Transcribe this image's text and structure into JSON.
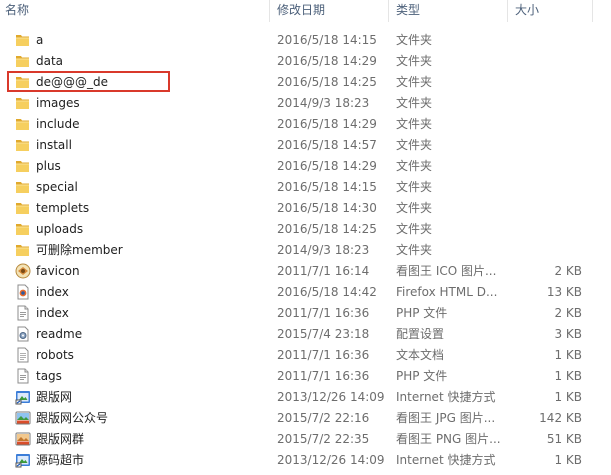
{
  "columns": {
    "name": "名称",
    "date": "修改日期",
    "type": "类型",
    "size": "大小"
  },
  "colors": {
    "folder": "#f0c24a",
    "highlight": "#d9392b"
  },
  "files": [
    {
      "name": "a",
      "date": "2016/5/18 14:15",
      "type": "文件夹",
      "size": "",
      "icon": "folder-icon"
    },
    {
      "name": "data",
      "date": "2016/5/18 14:29",
      "type": "文件夹",
      "size": "",
      "icon": "folder-icon"
    },
    {
      "name": "de@@@_de",
      "date": "2016/5/18 14:25",
      "type": "文件夹",
      "size": "",
      "icon": "folder-icon"
    },
    {
      "name": "images",
      "date": "2014/9/3 18:23",
      "type": "文件夹",
      "size": "",
      "icon": "folder-icon"
    },
    {
      "name": "include",
      "date": "2016/5/18 14:29",
      "type": "文件夹",
      "size": "",
      "icon": "folder-icon"
    },
    {
      "name": "install",
      "date": "2016/5/18 14:57",
      "type": "文件夹",
      "size": "",
      "icon": "folder-icon"
    },
    {
      "name": "plus",
      "date": "2016/5/18 14:29",
      "type": "文件夹",
      "size": "",
      "icon": "folder-icon"
    },
    {
      "name": "special",
      "date": "2016/5/18 14:15",
      "type": "文件夹",
      "size": "",
      "icon": "folder-icon"
    },
    {
      "name": "templets",
      "date": "2016/5/18 14:30",
      "type": "文件夹",
      "size": "",
      "icon": "folder-icon"
    },
    {
      "name": "uploads",
      "date": "2016/5/18 14:25",
      "type": "文件夹",
      "size": "",
      "icon": "folder-icon"
    },
    {
      "name": "可删除member",
      "date": "2014/9/3 18:23",
      "type": "文件夹",
      "size": "",
      "icon": "folder-icon"
    },
    {
      "name": "favicon",
      "date": "2011/7/1 16:14",
      "type": "看图王 ICO 图片...",
      "size": "2 KB",
      "icon": "ico-file-icon"
    },
    {
      "name": "index",
      "date": "2016/5/18 14:42",
      "type": "Firefox HTML D...",
      "size": "13 KB",
      "icon": "html-file-icon"
    },
    {
      "name": "index",
      "date": "2011/7/1 16:36",
      "type": "PHP 文件",
      "size": "2 KB",
      "icon": "php-file-icon"
    },
    {
      "name": "readme",
      "date": "2015/7/4 23:18",
      "type": "配置设置",
      "size": "3 KB",
      "icon": "config-file-icon"
    },
    {
      "name": "robots",
      "date": "2011/7/1 16:36",
      "type": "文本文档",
      "size": "1 KB",
      "icon": "text-file-icon"
    },
    {
      "name": "tags",
      "date": "2011/7/1 16:36",
      "type": "PHP 文件",
      "size": "1 KB",
      "icon": "php-file-icon"
    },
    {
      "name": "跟版网",
      "date": "2013/12/26 14:09",
      "type": "Internet 快捷方式",
      "size": "1 KB",
      "icon": "internet-shortcut-icon"
    },
    {
      "name": "跟版网公众号",
      "date": "2015/7/2 22:16",
      "type": "看图王 JPG 图片...",
      "size": "142 KB",
      "icon": "jpg-file-icon"
    },
    {
      "name": "跟版网群",
      "date": "2015/7/2 22:35",
      "type": "看图王 PNG 图片...",
      "size": "51 KB",
      "icon": "png-file-icon"
    },
    {
      "name": "源码超市",
      "date": "2013/12/26 14:09",
      "type": "Internet 快捷方式",
      "size": "1 KB",
      "icon": "internet-shortcut-icon"
    }
  ]
}
